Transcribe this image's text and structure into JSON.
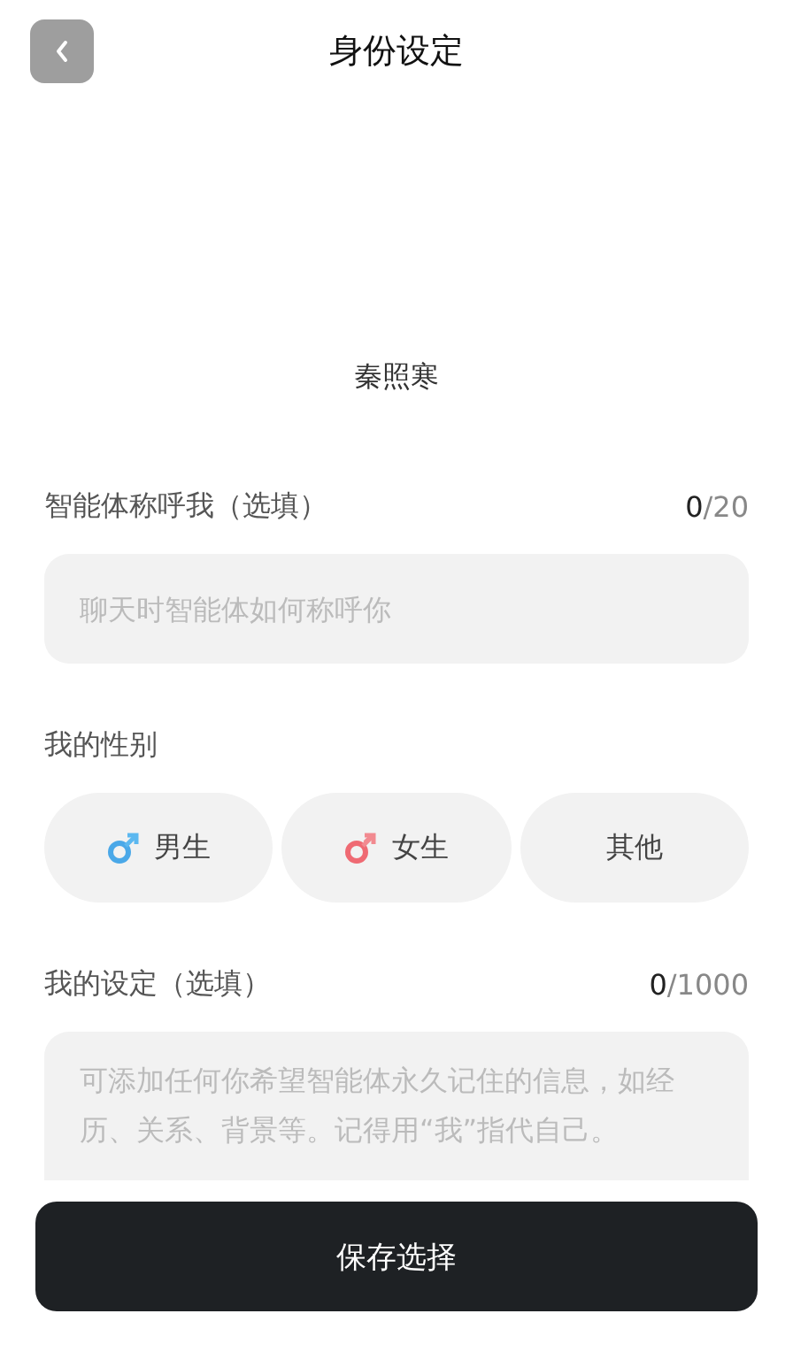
{
  "header": {
    "title": "身份设定"
  },
  "profile": {
    "name": "秦照寒"
  },
  "nickname": {
    "label": "智能体称呼我（选填）",
    "count": "0",
    "limit": "/20",
    "placeholder": "聊天时智能体如何称呼你"
  },
  "gender": {
    "label": "我的性别",
    "options": [
      {
        "label": "男生",
        "kind": "male",
        "selected": false
      },
      {
        "label": "女生",
        "kind": "female",
        "selected": false
      },
      {
        "label": "其他",
        "kind": "other",
        "selected": false
      }
    ]
  },
  "persona": {
    "label": "我的设定（选填）",
    "count": "0",
    "limit": "/1000",
    "placeholder": "可添加任何你希望智能体永久记住的信息，如经历、关系、背景等。记得用“我”指代自己。"
  },
  "save_button": {
    "label": "保存选择"
  }
}
